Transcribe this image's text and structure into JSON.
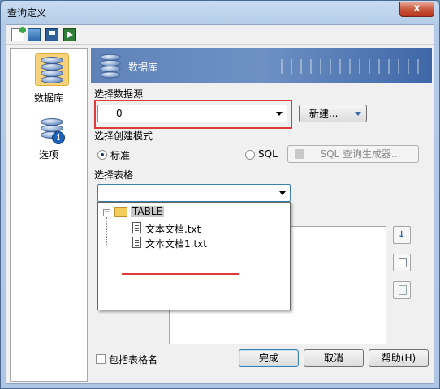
{
  "window": {
    "title": "查询定义",
    "close_label": "x"
  },
  "toolbar": {
    "icons": [
      "new-icon",
      "open-icon",
      "save-icon",
      "run-icon"
    ]
  },
  "sidebar": {
    "items": [
      {
        "label": "数据库",
        "icon": "database-icon",
        "selected": true
      },
      {
        "label": "选项",
        "icon": "options-icon",
        "selected": false
      }
    ]
  },
  "banner": {
    "title": "数据库"
  },
  "datasource": {
    "label": "选择数据源",
    "value": "0",
    "new_button": "新建..."
  },
  "mode": {
    "label": "选择创建模式",
    "standard": "标准",
    "sql": "SQL",
    "sql_builder": "SQL 查询生成器...",
    "selected": "standard"
  },
  "table": {
    "label": "选择表格",
    "value": "",
    "tree": {
      "root": "TABLE",
      "children": [
        "文本文档.txt",
        "文本文档1.txt"
      ]
    }
  },
  "include_table_name": {
    "label": "包括表格名",
    "checked": false
  },
  "footer": {
    "ok": "完成",
    "cancel": "取消",
    "help": "帮助(H)"
  },
  "accent": {
    "red": "#e0383b",
    "banner": "#5f83b9"
  }
}
